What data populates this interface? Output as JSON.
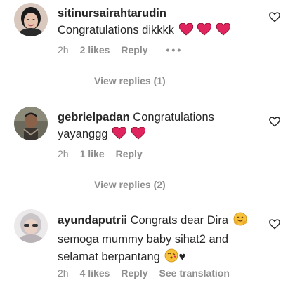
{
  "comments": [
    {
      "username": "sitinursairahtarudin",
      "line1": "Congratulations dikkkk",
      "time": "2h",
      "likes": "2 likes",
      "reply": "Reply",
      "more": "•••",
      "view_replies": "View replies (1)"
    },
    {
      "username": "gebrielpadan",
      "text_inline": "Congratulations",
      "line2": "yayanggg",
      "time": "2h",
      "likes": "1 like",
      "reply": "Reply",
      "view_replies": "View replies (2)"
    },
    {
      "username": "ayundaputrii",
      "text_inline": "Congrats dear Dira",
      "line2": "semoga mummy baby sihat2 and",
      "line3": "selamat berpantang",
      "line3_suffix": "♥",
      "time": "2h",
      "likes": "4 likes",
      "reply": "Reply",
      "see_translation": "See translation"
    }
  ],
  "icons": {
    "heart": "heart-outline-icon",
    "red_heart": "red-heart-emoji",
    "hug": "hugging-face-emoji",
    "kiss": "face-blowing-kiss-emoji"
  },
  "colors": {
    "text": "#262626",
    "muted": "#8e8e8e",
    "heart_red": "#e0245e"
  }
}
